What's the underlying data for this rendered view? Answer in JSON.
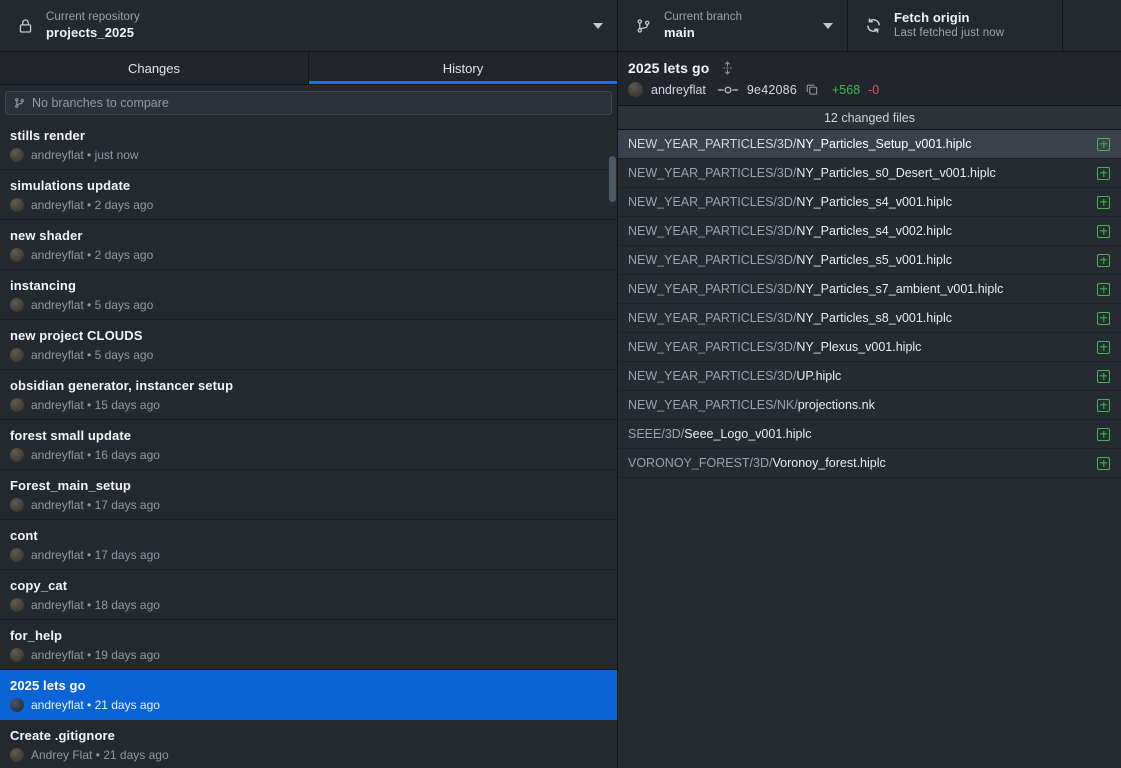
{
  "toolbar": {
    "repository": {
      "icon": "lock-icon",
      "label": "Current repository",
      "value": "projects_2025",
      "caret": "chevron-down-icon"
    },
    "branch": {
      "icon": "git-branch-icon",
      "label": "Current branch",
      "value": "main",
      "caret": "chevron-down-icon"
    },
    "fetch": {
      "icon": "sync-icon",
      "title": "Fetch origin",
      "subtitle": "Last fetched just now"
    }
  },
  "left_panel": {
    "tabs": [
      {
        "label": "Changes",
        "active": false
      },
      {
        "label": "History",
        "active": true
      }
    ],
    "compare": {
      "icon": "git-branch-icon",
      "placeholder": "No branches to compare",
      "value": ""
    },
    "commits": [
      {
        "title": "stills render",
        "author": "andreyflat",
        "when": "just now",
        "selected": false
      },
      {
        "title": "simulations update",
        "author": "andreyflat",
        "when": "2 days ago",
        "selected": false
      },
      {
        "title": "new shader",
        "author": "andreyflat",
        "when": "2 days ago",
        "selected": false
      },
      {
        "title": "instancing",
        "author": "andreyflat",
        "when": "5 days ago",
        "selected": false
      },
      {
        "title": "new project CLOUDS",
        "author": "andreyflat",
        "when": "5 days ago",
        "selected": false
      },
      {
        "title": "obsidian generator, instancer setup",
        "author": "andreyflat",
        "when": "15 days ago",
        "selected": false
      },
      {
        "title": "forest small update",
        "author": "andreyflat",
        "when": "16 days ago",
        "selected": false
      },
      {
        "title": "Forest_main_setup",
        "author": "andreyflat",
        "when": "17 days ago",
        "selected": false
      },
      {
        "title": "cont",
        "author": "andreyflat",
        "when": "17 days ago",
        "selected": false
      },
      {
        "title": "copy_cat",
        "author": "andreyflat",
        "when": "18 days ago",
        "selected": false
      },
      {
        "title": "for_help",
        "author": "andreyflat",
        "when": "19 days ago",
        "selected": false
      },
      {
        "title": "2025 lets go",
        "author": "andreyflat",
        "when": "21 days ago",
        "selected": true
      },
      {
        "title": "Create .gitignore",
        "author": "Andrey Flat",
        "when": "21 days ago",
        "selected": false
      }
    ]
  },
  "right_panel": {
    "commit": {
      "title": "2025 lets go",
      "expander_icon": "expand-vertical-icon",
      "author": "andreyflat",
      "node_icon": "commit-node-icon",
      "sha": "9e42086",
      "copy_icon": "copy-icon",
      "additions": "+568",
      "deletions": "-0"
    },
    "files_header": "12 changed files",
    "files": [
      {
        "path": "NEW_YEAR_PARTICLES/3D/",
        "name": "NY_Particles_Setup_v001.hiplc",
        "status": "added",
        "selected": true
      },
      {
        "path": "NEW_YEAR_PARTICLES/3D/",
        "name": "NY_Particles_s0_Desert_v001.hiplc",
        "status": "added",
        "selected": false
      },
      {
        "path": "NEW_YEAR_PARTICLES/3D/",
        "name": "NY_Particles_s4_v001.hiplc",
        "status": "added",
        "selected": false
      },
      {
        "path": "NEW_YEAR_PARTICLES/3D/",
        "name": "NY_Particles_s4_v002.hiplc",
        "status": "added",
        "selected": false
      },
      {
        "path": "NEW_YEAR_PARTICLES/3D/",
        "name": "NY_Particles_s5_v001.hiplc",
        "status": "added",
        "selected": false
      },
      {
        "path": "NEW_YEAR_PARTICLES/3D/",
        "name": "NY_Particles_s7_ambient_v001.hiplc",
        "status": "added",
        "selected": false
      },
      {
        "path": "NEW_YEAR_PARTICLES/3D/",
        "name": "NY_Particles_s8_v001.hiplc",
        "status": "added",
        "selected": false
      },
      {
        "path": "NEW_YEAR_PARTICLES/3D/",
        "name": "NY_Plexus_v001.hiplc",
        "status": "added",
        "selected": false
      },
      {
        "path": "NEW_YEAR_PARTICLES/3D/",
        "name": "UP.hiplc",
        "status": "added",
        "selected": false
      },
      {
        "path": "NEW_YEAR_PARTICLES/NK/",
        "name": "projections.nk",
        "status": "added",
        "selected": false
      },
      {
        "path": "SEEE/3D/",
        "name": "Seee_Logo_v001.hiplc",
        "status": "added",
        "selected": false
      },
      {
        "path": "VORONOY_FOREST/3D/",
        "name": "Voronoy_forest.hiplc",
        "status": "added",
        "selected": false
      }
    ]
  },
  "colors": {
    "accent_blue": "#1f6feb",
    "selection_blue": "#0a64d6",
    "added_green": "#3fb950",
    "deleted_red": "#d6585f",
    "toolbar_bg": "#24292e",
    "panel_bg": "#262b31"
  }
}
